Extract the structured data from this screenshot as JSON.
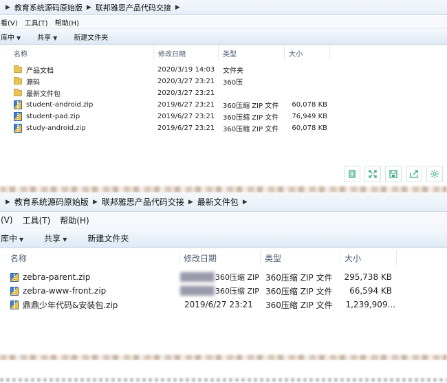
{
  "top": {
    "breadcrumb": [
      "教育系统源码原始版",
      "联邦雅思产品代码交接"
    ],
    "menu": [
      "看(V)",
      "工具(T)",
      "帮助(H)"
    ],
    "toolbar": {
      "include": "库中",
      "share": "共享",
      "new_folder": "新建文件夹"
    },
    "columns": {
      "name": "名称",
      "date": "修改日期",
      "type": "类型",
      "size": "大小"
    },
    "files": [
      {
        "icon": "folder",
        "name": "产品文档",
        "date": "2020/3/19 14:03",
        "type": "文件夹",
        "size": ""
      },
      {
        "icon": "folder",
        "name": "源码",
        "date": "2020/3/27 23:21",
        "type": "360压",
        "size": ""
      },
      {
        "icon": "folder",
        "name": "最新文件包",
        "date": "2020/3/27 23:21",
        "type": "",
        "size": ""
      },
      {
        "icon": "zip",
        "name": "student-android.zip",
        "date": "2019/6/27 23:21",
        "type": "360压缩 ZIP 文件",
        "size": "60,078 KB"
      },
      {
        "icon": "zip",
        "name": "student-pad.zip",
        "date": "2019/6/27 23:21",
        "type": "360压缩 ZIP 文件",
        "size": "76,949 KB"
      },
      {
        "icon": "zip",
        "name": "study-android.zip",
        "date": "2019/6/27 23:21",
        "type": "360压缩 ZIP 文件",
        "size": "60,078 KB"
      }
    ]
  },
  "bottom": {
    "breadcrumb": [
      "教育系统源码原始版",
      "联邦雅思产品代码交接",
      "最新文件包"
    ],
    "menu": [
      "(V)",
      "工具(T)",
      "帮助(H)"
    ],
    "toolbar": {
      "include": "库中",
      "share": "共享",
      "new_folder": "新建文件夹"
    },
    "columns": {
      "name": "名称",
      "date": "修改日期",
      "type": "类型",
      "size": "大小"
    },
    "files": [
      {
        "icon": "zip",
        "name": "zebra-parent.zip",
        "date": "",
        "prefix": "360压缩 ZIP",
        "type": "360压缩 ZIP 文件",
        "size": "295,738 KB"
      },
      {
        "icon": "zip",
        "name": "zebra-www-front.zip",
        "date": "",
        "prefix": "360压缩 ZIP",
        "type": "360压缩 ZIP 文件",
        "size": "66,594 KB"
      },
      {
        "icon": "zip",
        "name": "鼎鼎少年代码&安装包.zip",
        "date": "2019/6/27 23:21",
        "prefix": "",
        "type": "360压缩 ZIP 文件",
        "size": "1,239,909..."
      }
    ]
  }
}
